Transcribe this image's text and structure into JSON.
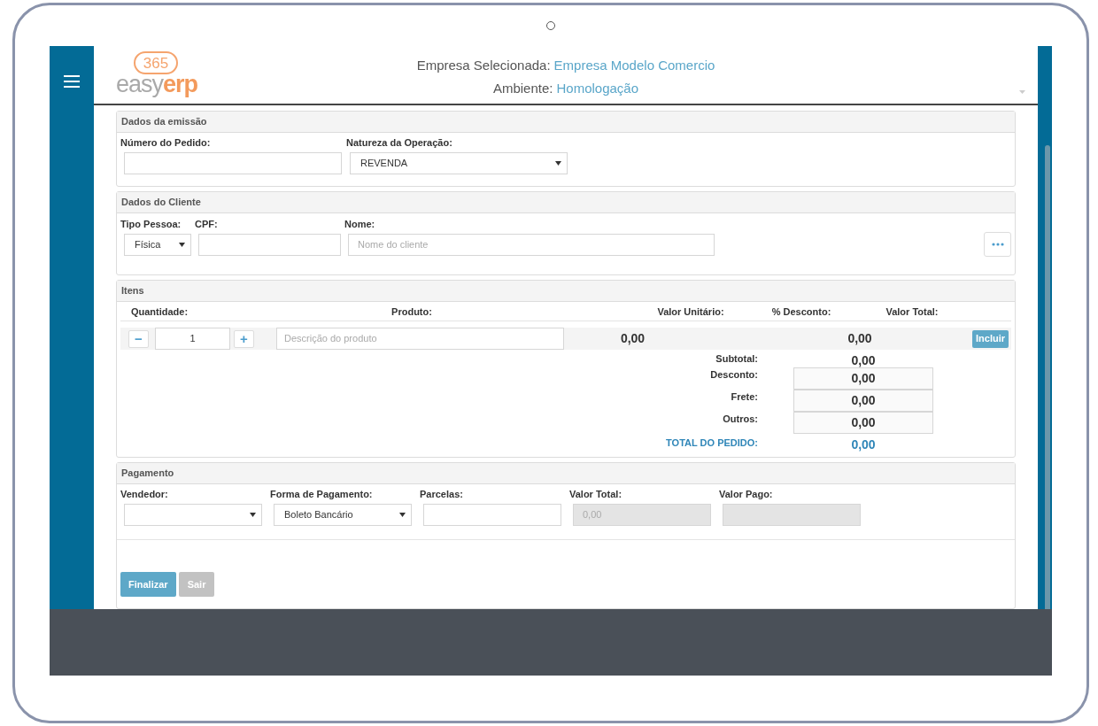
{
  "header": {
    "logo": {
      "badge": "365",
      "word_a": "easy",
      "word_b": "erp"
    },
    "company_label": "Empresa Selecionada:",
    "company_value": "Empresa Modelo Comercio",
    "environment_label": "Ambiente:",
    "environment_value": "Homologação"
  },
  "emission": {
    "title": "Dados da emissão",
    "fields": [
      {
        "label": "Número do Pedido:",
        "kind": "input",
        "disabled": false
      },
      {
        "label": "Natureza da Operação:",
        "kind": "select",
        "value": "REVENDA",
        "disabled": false
      }
    ]
  },
  "client": {
    "title": "Dados do Cliente",
    "fields": [
      {
        "label": "Tipo Pessoa:",
        "kind": "select",
        "value": "Física",
        "disabled": false
      },
      {
        "label": "CPF:",
        "kind": "input",
        "disabled": false
      },
      {
        "label": "Nome:",
        "kind": "input",
        "placeholder": "Nome do cliente",
        "disabled": false
      }
    ]
  },
  "items": {
    "title": "Itens",
    "columns": [
      "Quantidade:",
      "Produto:",
      "Valor Unitário:",
      "% Desconto:",
      "Valor Total:"
    ],
    "row": {
      "minus": "−",
      "quantity": "1",
      "plus": "+",
      "product_placeholder": "Descrição do produto",
      "unit_value": "0,00",
      "total_value": "0,00",
      "add_button": "Incluir"
    },
    "summary": [
      {
        "label": "Subtotal:",
        "value": "0,00",
        "kind": "text"
      },
      {
        "label": "Desconto:",
        "value": "0,00",
        "kind": "input"
      },
      {
        "label": "Frete:",
        "value": "0,00",
        "kind": "input"
      },
      {
        "label": "Outros:",
        "value": "0,00",
        "kind": "input"
      },
      {
        "label": "TOTAL DO PEDIDO:",
        "value": "0,00",
        "kind": "total"
      }
    ]
  },
  "payment": {
    "title": "Pagamento",
    "fields": [
      {
        "label": "Vendedor:",
        "kind": "select",
        "disabled": false
      },
      {
        "label": "Forma de Pagamento:",
        "kind": "select",
        "value": "Boleto Bancário",
        "disabled": false
      },
      {
        "label": "Parcelas:",
        "kind": "input",
        "disabled": false
      },
      {
        "label": "Valor Total:",
        "kind": "input",
        "placeholder": "0,00",
        "disabled": true
      },
      {
        "label": "Valor Pago:",
        "kind": "input",
        "disabled": true
      }
    ]
  },
  "buttons": [
    {
      "label": "Finalizar",
      "kind": "primary"
    },
    {
      "label": "Sair",
      "kind": "secondary"
    }
  ]
}
